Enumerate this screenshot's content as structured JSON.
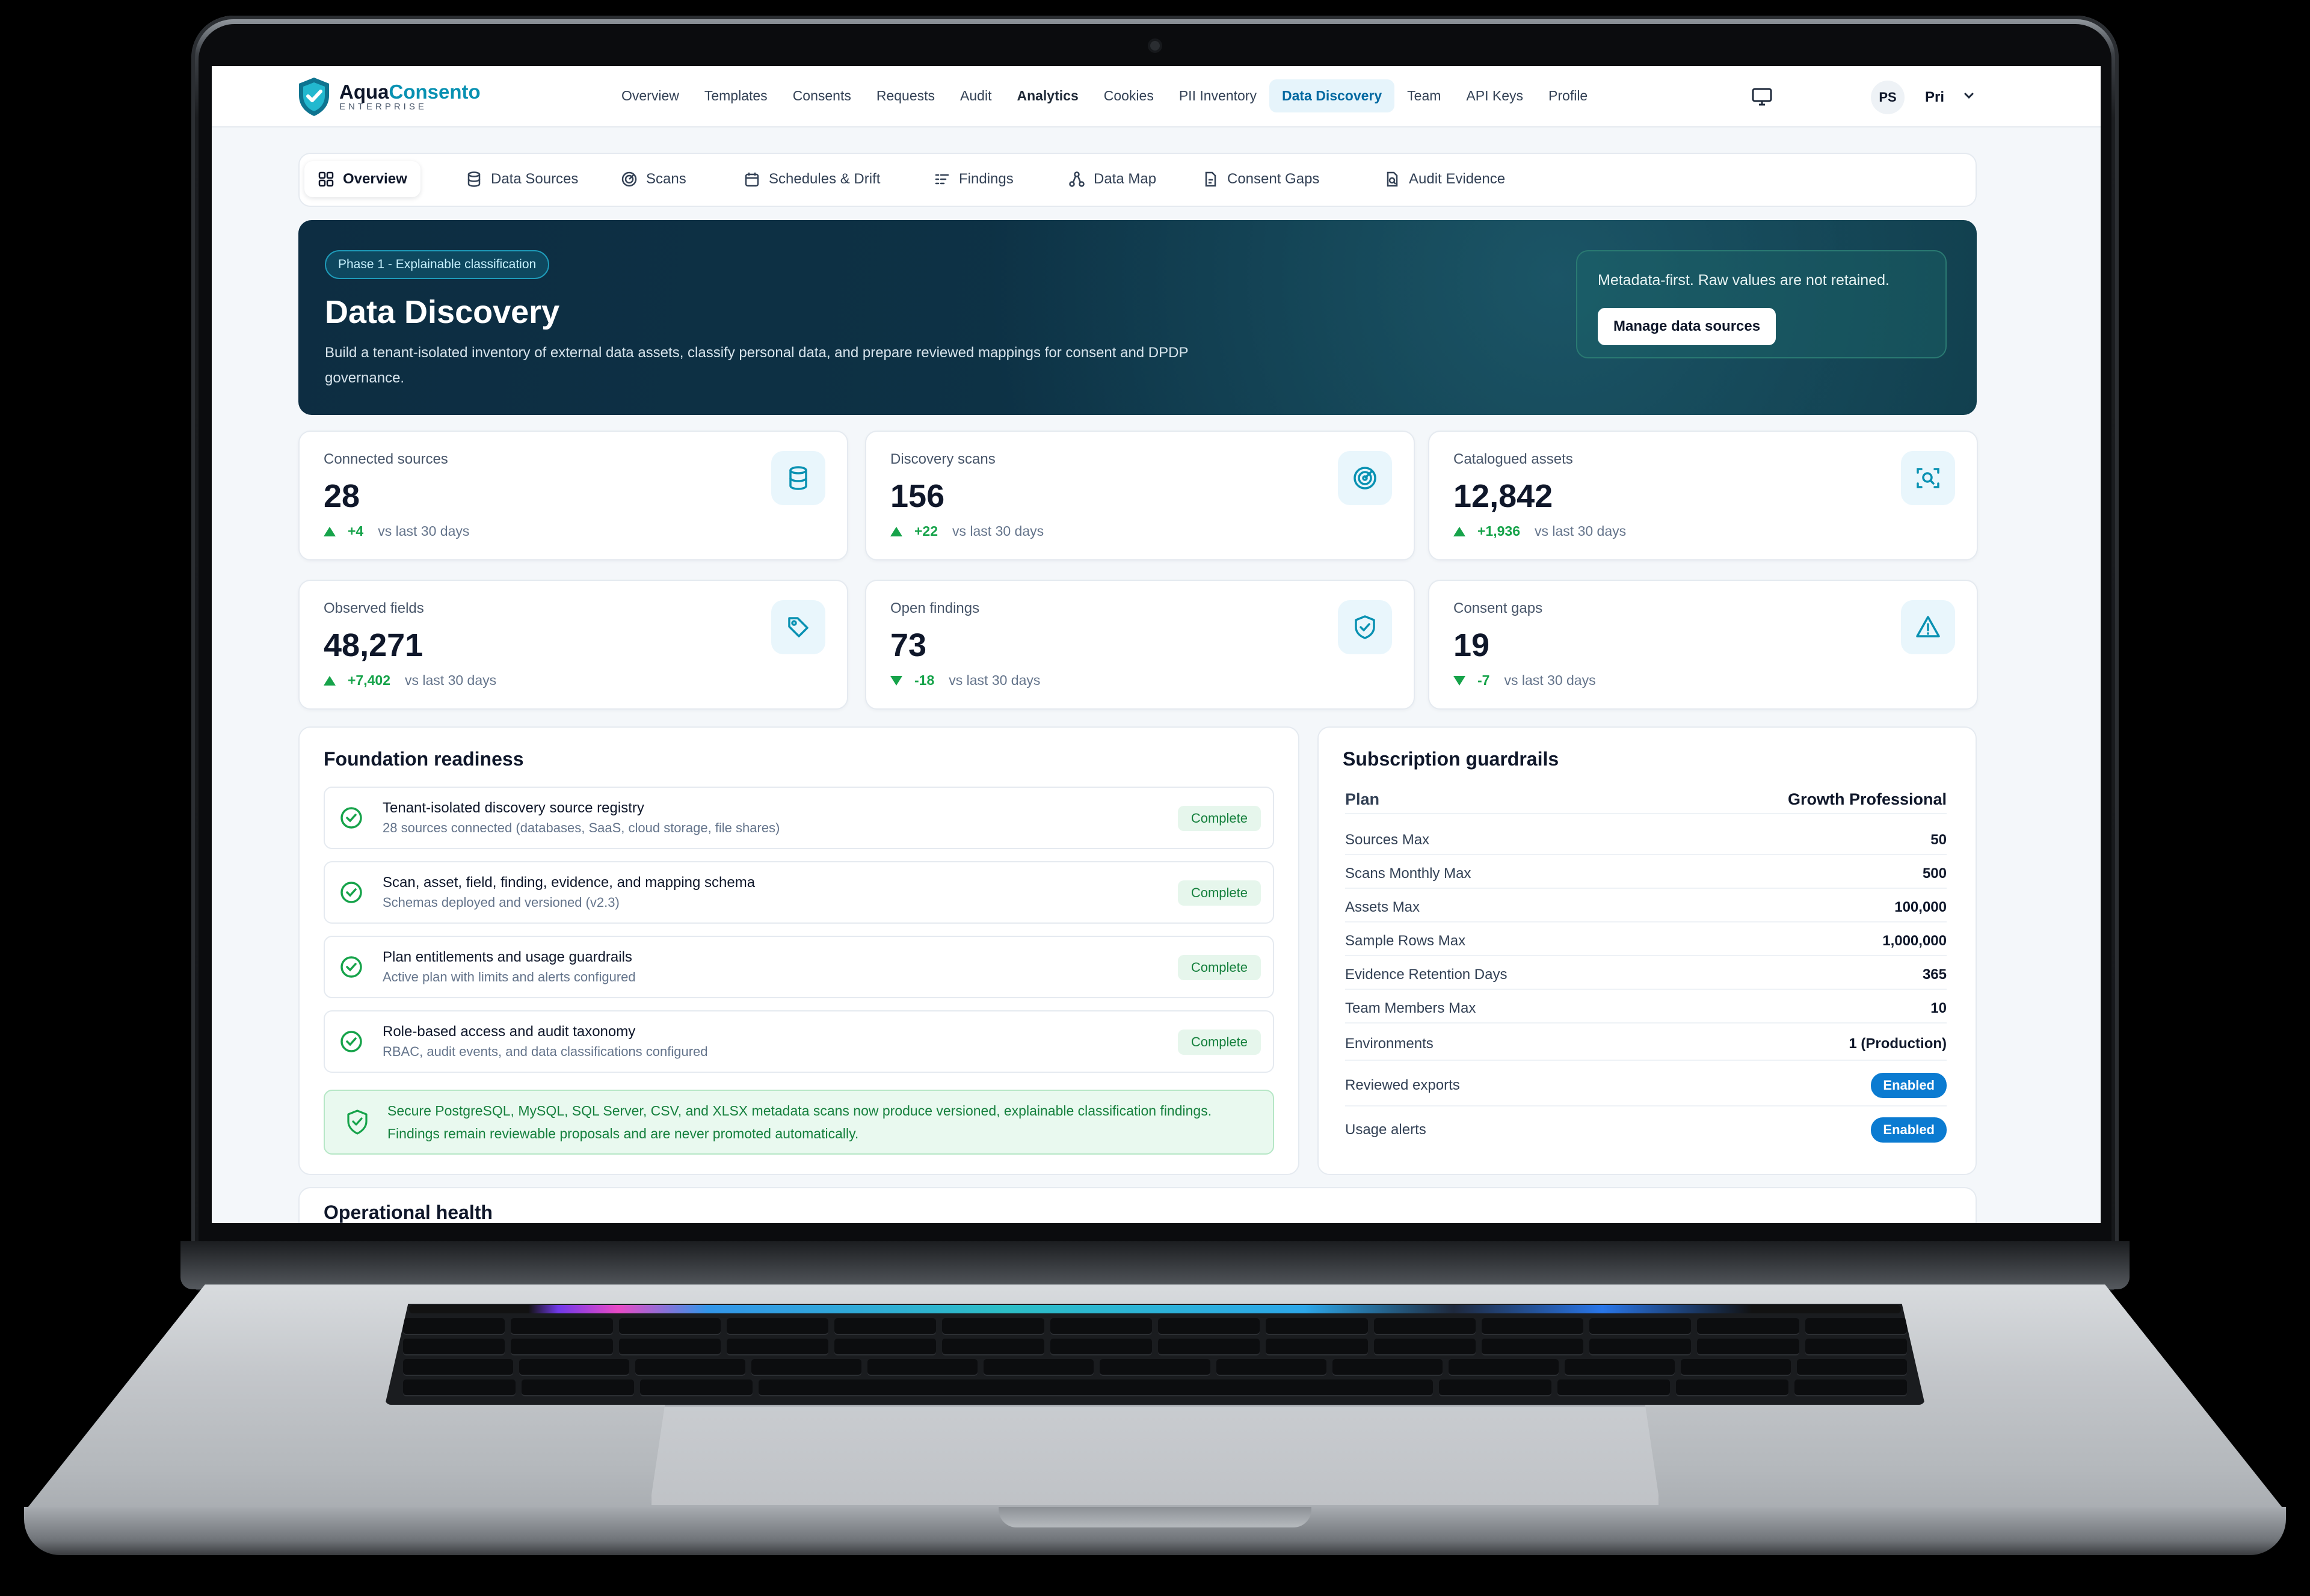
{
  "brand": {
    "name_part1": "Aqua",
    "name_part2": "Consento",
    "edition": "ENTERPRISE"
  },
  "nav": {
    "links": [
      "Overview",
      "Templates",
      "Consents",
      "Requests",
      "Audit",
      "Analytics",
      "Cookies",
      "PII Inventory",
      "Data Discovery",
      "Team",
      "API Keys",
      "Profile"
    ],
    "active": "Data Discovery",
    "bold": "Analytics",
    "user_initials": "PS",
    "user_name": "Pri"
  },
  "subtabs": [
    "Overview",
    "Data Sources",
    "Scans",
    "Schedules & Drift",
    "Findings",
    "Data Map",
    "Consent Gaps",
    "Audit Evidence"
  ],
  "hero": {
    "badge": "Phase 1 - Explainable classification",
    "title": "Data Discovery",
    "description": "Build a tenant-isolated inventory of external data assets, classify personal data, and prepare reviewed mappings for consent and DPDP governance.",
    "note": "Metadata-first. Raw values are not retained.",
    "button": "Manage data sources"
  },
  "kpis": [
    {
      "label": "Connected sources",
      "value": "28",
      "delta": "+4",
      "direction": "up",
      "period": "vs last 30 days",
      "icon": "database-icon"
    },
    {
      "label": "Discovery scans",
      "value": "156",
      "delta": "+22",
      "direction": "up",
      "period": "vs last 30 days",
      "icon": "radar-icon"
    },
    {
      "label": "Catalogued assets",
      "value": "12,842",
      "delta": "+1,936",
      "direction": "up",
      "period": "vs last 30 days",
      "icon": "scan-search-icon"
    },
    {
      "label": "Observed fields",
      "value": "48,271",
      "delta": "+7,402",
      "direction": "up",
      "period": "vs last 30 days",
      "icon": "tag-icon"
    },
    {
      "label": "Open findings",
      "value": "73",
      "delta": "-18",
      "direction": "down",
      "period": "vs last 30 days",
      "icon": "shield-check-icon"
    },
    {
      "label": "Consent gaps",
      "value": "19",
      "delta": "-7",
      "direction": "down",
      "period": "vs last 30 days",
      "icon": "warning-icon"
    }
  ],
  "readiness": {
    "title": "Foundation readiness",
    "items": [
      {
        "title": "Tenant-isolated discovery source registry",
        "subtitle": "28 sources connected (databases, SaaS, cloud storage, file shares)",
        "status": "Complete"
      },
      {
        "title": "Scan, asset, field, finding, evidence, and mapping schema",
        "subtitle": "Schemas deployed and versioned (v2.3)",
        "status": "Complete"
      },
      {
        "title": "Plan entitlements and usage guardrails",
        "subtitle": "Active plan with limits and alerts configured",
        "status": "Complete"
      },
      {
        "title": "Role-based access and audit taxonomy",
        "subtitle": "RBAC, audit events, and data classifications configured",
        "status": "Complete"
      }
    ],
    "note": "Secure PostgreSQL, MySQL, SQL Server, CSV, and XLSX metadata scans now produce versioned, explainable classification findings. Findings remain reviewable proposals and are never promoted automatically."
  },
  "guardrails": {
    "title": "Subscription guardrails",
    "plan_label": "Plan",
    "plan_value": "Growth Professional",
    "rows": [
      {
        "label": "Sources Max",
        "value": "50"
      },
      {
        "label": "Scans Monthly Max",
        "value": "500"
      },
      {
        "label": "Assets Max",
        "value": "100,000"
      },
      {
        "label": "Sample Rows Max",
        "value": "1,000,000"
      },
      {
        "label": "Evidence Retention Days",
        "value": "365"
      },
      {
        "label": "Team Members Max",
        "value": "10"
      },
      {
        "label": "Environments",
        "value": "1 (Production)"
      }
    ],
    "toggles": [
      {
        "label": "Reviewed exports",
        "value": "Enabled"
      },
      {
        "label": "Usage alerts",
        "value": "Enabled"
      }
    ]
  },
  "operational": {
    "title": "Operational health"
  },
  "colors": {
    "accent": "#0891b2",
    "nav_active_bg": "#e6f4fb",
    "hero_bg": "#0d2d42",
    "success": "#16a34a",
    "pill": "#0b7bd1"
  }
}
